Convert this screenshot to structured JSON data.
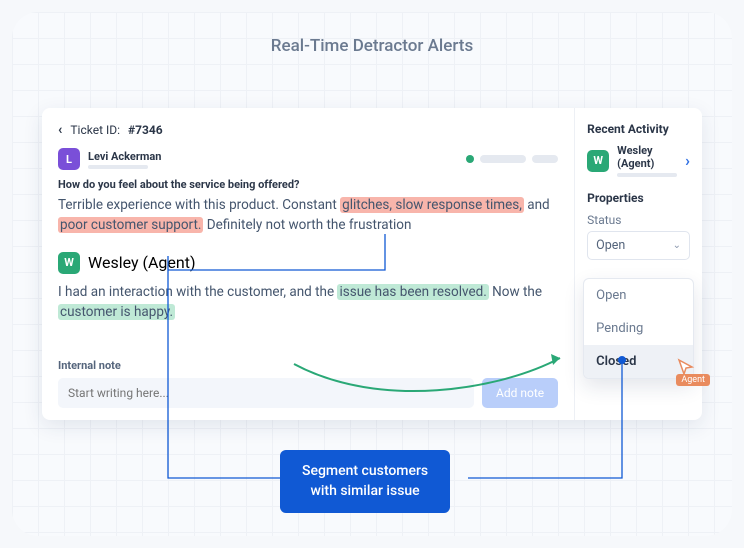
{
  "title": "Real-Time Detractor Alerts",
  "ticket": {
    "label": "Ticket ID:",
    "id": "#7346"
  },
  "customer": {
    "initial": "L",
    "name": "Levi Ackerman"
  },
  "question": "How do you feel about the service being offered?",
  "msg1": {
    "pre1": "Terrible experience with this product. Constant ",
    "h1": "glitches, slow response times,",
    "mid": " and ",
    "h2": "poor customer support.",
    "post": " Definitely not worth the frustration"
  },
  "agent": {
    "initial": "W",
    "name": "Wesley (Agent)"
  },
  "msg2": {
    "pre1": "I had an interaction with the customer, and the ",
    "h1": "issue has been resolved.",
    "pre2": " Now the ",
    "h2": "customer is happy."
  },
  "note": {
    "label": "Internal note",
    "placeholder": "Start writing here...",
    "button": "Add note"
  },
  "side": {
    "recent": "Recent Activity",
    "properties": "Properties",
    "status_label": "Status",
    "status_value": "Open",
    "options": [
      "Open",
      "Pending",
      "Closed"
    ]
  },
  "cursor_tag": "Agent",
  "callout": {
    "line1": "Segment customers",
    "line2": "with similar issue"
  }
}
